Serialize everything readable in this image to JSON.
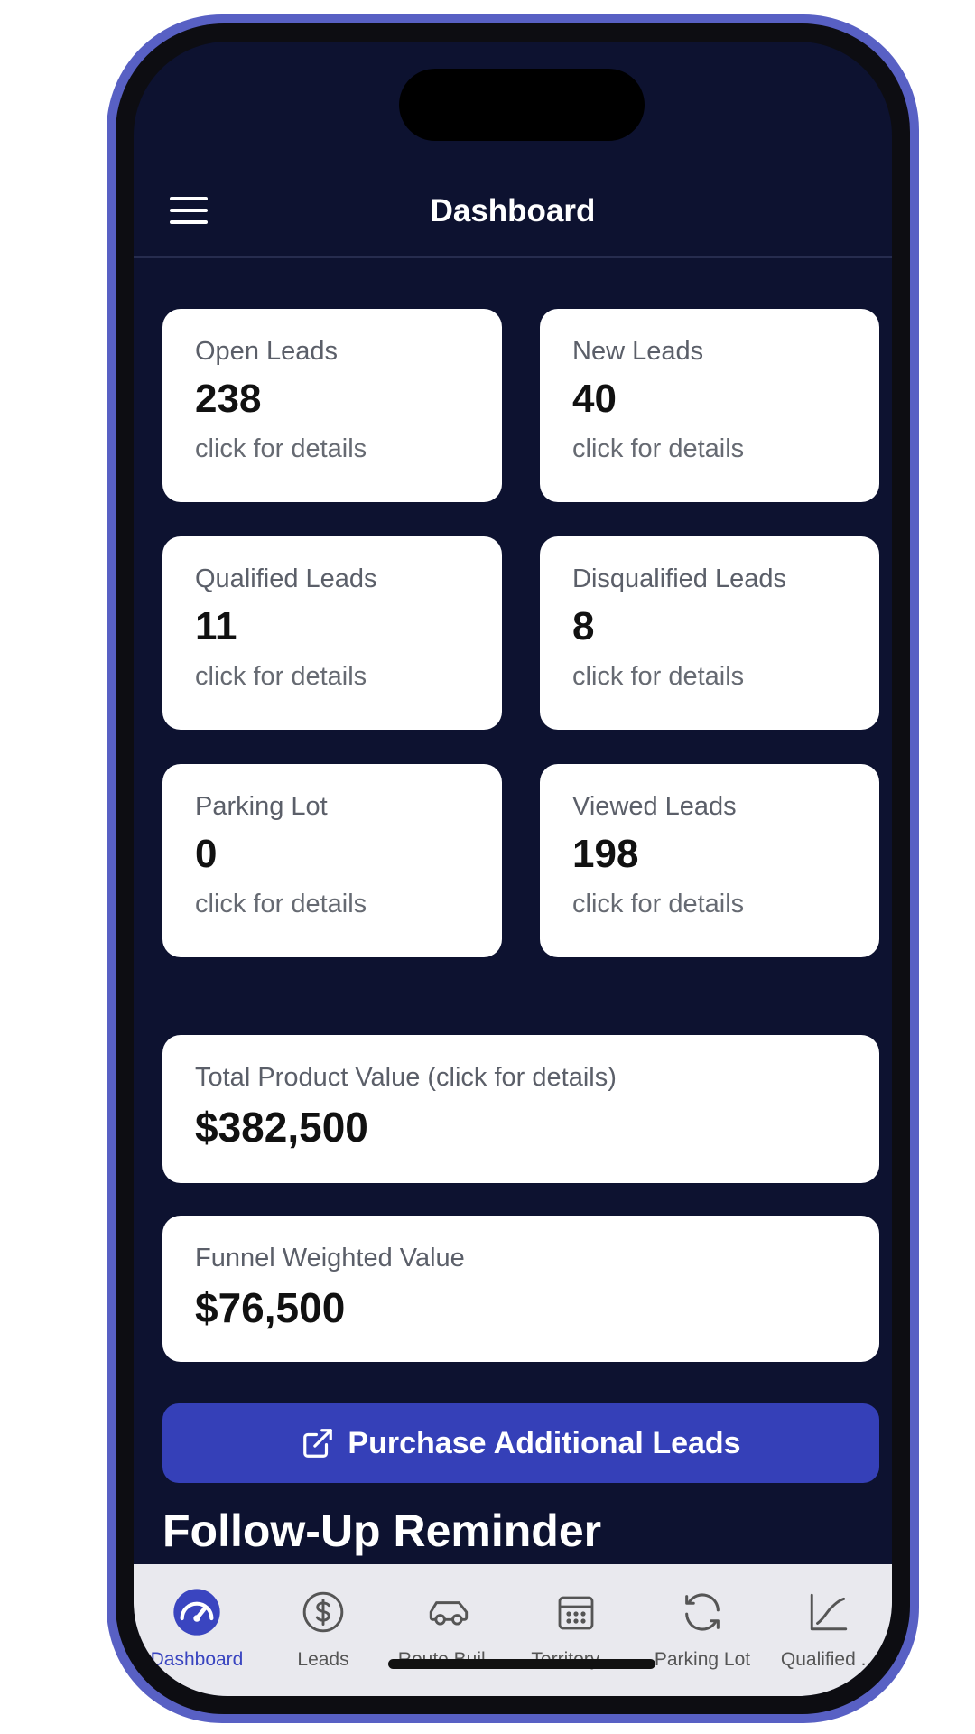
{
  "header": {
    "title": "Dashboard"
  },
  "stats": [
    {
      "label": "Open Leads",
      "value": "238",
      "hint": "click for details"
    },
    {
      "label": "New Leads",
      "value": "40",
      "hint": "click for details"
    },
    {
      "label": "Qualified Leads",
      "value": "11",
      "hint": "click for details"
    },
    {
      "label": "Disqualified Leads",
      "value": "8",
      "hint": "click for details"
    },
    {
      "label": "Parking Lot",
      "value": "0",
      "hint": "click for details"
    },
    {
      "label": "Viewed Leads",
      "value": "198",
      "hint": "click for details"
    }
  ],
  "total_product": {
    "label": "Total Product Value (click for details)",
    "value": "$382,500"
  },
  "funnel": {
    "label": "Funnel Weighted Value",
    "value": "$76,500"
  },
  "purchase_button": {
    "label": "Purchase Additional Leads",
    "icon": "external-link-icon"
  },
  "follow_up": {
    "title": "Follow-Up Reminder"
  },
  "nav": {
    "active_color": "#3a45c0",
    "items": [
      {
        "label": "Dashboard",
        "icon": "speedometer-icon"
      },
      {
        "label": "Leads",
        "icon": "dollar-circle-icon"
      },
      {
        "label": "Route Buil...",
        "icon": "car-icon"
      },
      {
        "label": "Territory ...",
        "icon": "calendar-icon"
      },
      {
        "label": "Parking Lot",
        "icon": "refresh-icon"
      },
      {
        "label": "Qualified ...",
        "icon": "chart-line-icon"
      }
    ]
  },
  "colors": {
    "background": "#0d1230",
    "accent": "#3540b8",
    "frame": "#5860c4"
  }
}
